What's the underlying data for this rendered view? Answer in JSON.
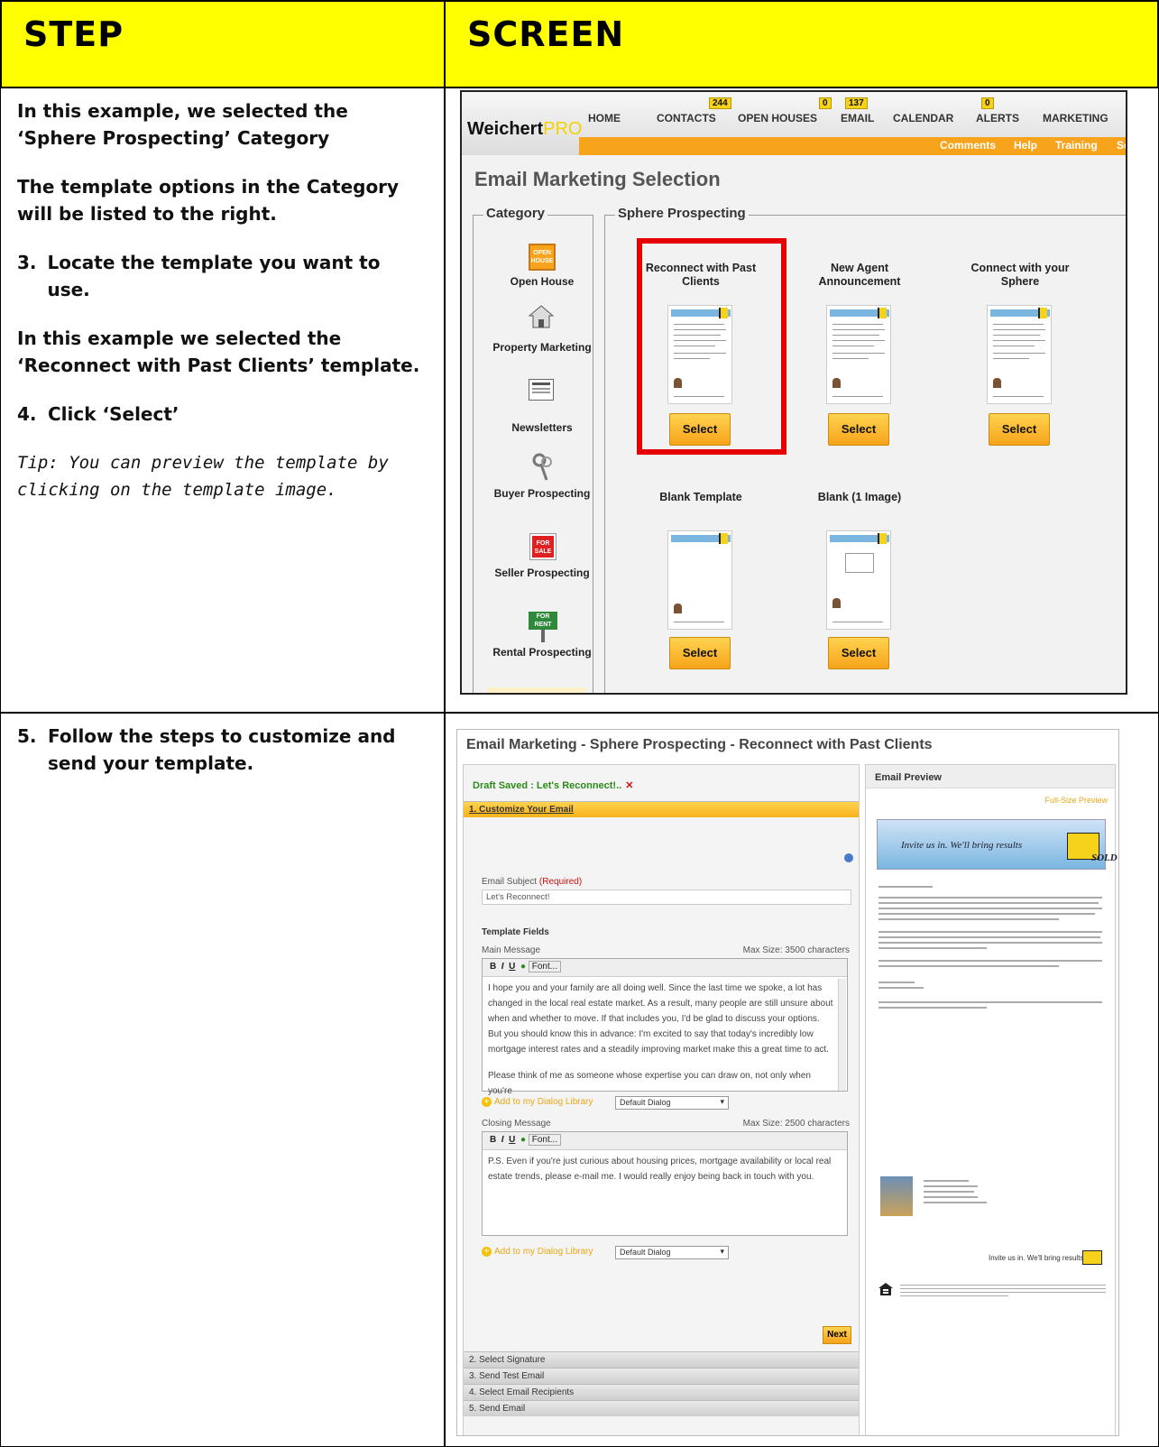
{
  "header": {
    "step": "STEP",
    "screen": "SCREEN"
  },
  "row1": {
    "para1": "In this example, we selected the ‘Sphere Prospecting’ Category",
    "para2": "The template options in the Category will be listed to the right.",
    "item3_num": "3.",
    "item3": "Locate the template you want to use.",
    "para3": "In this example we selected the ‘Reconnect with Past Clients’ template.",
    "item4_num": "4.",
    "item4": "Click ‘Select’",
    "tip": "Tip: You can preview the template by clicking on the template image."
  },
  "row2": {
    "item5_num": "5.",
    "item5": "Follow the steps to customize and send your template."
  },
  "screen1": {
    "logo_main": "Weichert",
    "logo_sub": "PRO",
    "nav": [
      {
        "label": "HOME",
        "badge": ""
      },
      {
        "label": "CONTACTS",
        "badge": "244"
      },
      {
        "label": "OPEN HOUSES",
        "badge": ""
      },
      {
        "label": "EMAIL",
        "badge": "137"
      },
      {
        "label": "CALENDAR",
        "badge": ""
      },
      {
        "label": "ALERTS",
        "badge": "0"
      },
      {
        "label": "MARKETING",
        "badge": ""
      }
    ],
    "open_houses_badge": "0",
    "subnav": [
      "Comments",
      "Help",
      "Training",
      "Se"
    ],
    "page_title": "Email Marketing Selection",
    "category_legend": "Category",
    "sphere_legend": "Sphere Prospecting",
    "categories": [
      "Open House",
      "Property Marketing",
      "Newsletters",
      "Buyer Prospecting",
      "Seller Prospecting",
      "Rental Prospecting"
    ],
    "templates": [
      "Reconnect with Past Clients",
      "New Agent Announcement",
      "Connect with your Sphere",
      "Blank Template",
      "Blank (1 Image)"
    ],
    "select_label": "Select",
    "open_sign": "OPEN HOUSE",
    "sale_sign": "FOR SALE",
    "rent_sign": "FOR RENT"
  },
  "screen2": {
    "title": "Email Marketing  - Sphere Prospecting - Reconnect with Past Clients",
    "draft": "Draft Saved : Let's Reconnect!..",
    "step1": "1. Customize Your Email",
    "subject_label": "Email Subject",
    "subject_required": "(Required)",
    "subject_value": "Let's Reconnect!",
    "template_fields": "Template Fields",
    "main_message": "Main Message",
    "main_max": "Max Size: 3500 characters",
    "toolbar_font": "Font...",
    "main_text": "I hope you and your family are all doing well. Since the last time we spoke, a lot has changed in the local real estate market. As a result, many people are still unsure about when and whether to move. If that includes you, I'd be glad to discuss your options. But you should know this in advance: I'm excited to say that today's incredibly low mortgage interest rates and a steadily improving market make this a great time to act.",
    "main_text2": "Please think of me as someone whose expertise you can draw on, not only when you're",
    "add_library": "Add to my Dialog Library",
    "default_dialog": "Default Dialog",
    "closing_message": "Closing Message",
    "closing_max": "Max Size: 2500 characters",
    "closing_text": "P.S. Even if you're just curious about housing prices, mortgage availability or local real estate trends, please e-mail me. I would really enjoy being back in touch with you.",
    "next": "Next",
    "steps": [
      "2. Select Signature",
      "3. Send Test Email",
      "4. Select Email Recipients",
      "5. Send Email"
    ],
    "preview_title": "Email Preview",
    "full_size": "Full-Size Preview",
    "banner_text": "Invite us in. We'll bring results",
    "sold": "SOLD",
    "footer_tag": "Invite us in. We'll bring results."
  }
}
